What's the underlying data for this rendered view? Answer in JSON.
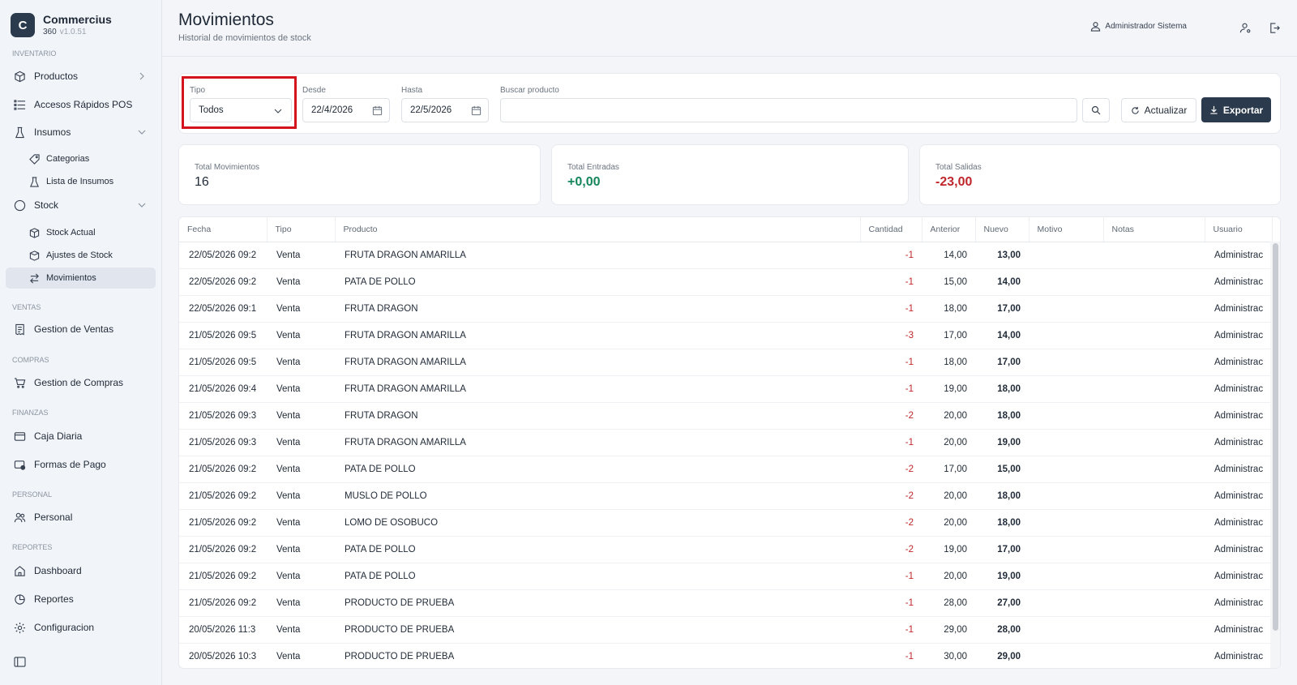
{
  "brand": {
    "logo_letter": "C",
    "name": "Commercius",
    "product": "360",
    "version": "v1.0.51"
  },
  "sidebar": {
    "sections": {
      "inventario": "INVENTARIO",
      "ventas": "VENTAS",
      "compras": "COMPRAS",
      "finanzas": "FINANZAS",
      "personal": "PERSONAL",
      "reportes": "REPORTES"
    },
    "items": {
      "productos": "Productos",
      "accesos": "Accesos Rápidos POS",
      "insumos": "Insumos",
      "categorias": "Categorias",
      "lista_insumos": "Lista de Insumos",
      "stock": "Stock",
      "stock_actual": "Stock Actual",
      "ajustes": "Ajustes de Stock",
      "movimientos": "Movimientos",
      "gestion_ventas": "Gestion de Ventas",
      "gestion_compras": "Gestion de Compras",
      "caja": "Caja Diaria",
      "formas_pago": "Formas de Pago",
      "personal": "Personal",
      "dashboard": "Dashboard",
      "reportes": "Reportes",
      "configuracion": "Configuracion"
    },
    "active_item": "movimientos"
  },
  "header": {
    "title": "Movimientos",
    "subtitle": "Historial de movimientos de stock",
    "user": "Administrador Sistema"
  },
  "filters": {
    "tipo_label": "Tipo",
    "tipo_value": "Todos",
    "desde_label": "Desde",
    "desde_value": "22/4/2026",
    "hasta_label": "Hasta",
    "hasta_value": "22/5/2026",
    "buscar_label": "Buscar producto",
    "buscar_value": "",
    "actualizar": "Actualizar",
    "exportar": "Exportar"
  },
  "stats": {
    "total_mov_label": "Total Movimientos",
    "total_mov_value": "16",
    "entradas_label": "Total Entradas",
    "entradas_value": "+0,00",
    "salidas_label": "Total Salidas",
    "salidas_value": "-23,00"
  },
  "table": {
    "headers": [
      "Fecha",
      "Tipo",
      "Producto",
      "Cantidad",
      "Anterior",
      "Nuevo",
      "Motivo",
      "Notas",
      "Usuario"
    ],
    "rows": [
      [
        "22/05/2026 09:2",
        "Venta",
        "FRUTA DRAGON AMARILLA",
        "-1",
        "14,00",
        "13,00",
        "",
        "",
        "Administrac"
      ],
      [
        "22/05/2026 09:2",
        "Venta",
        "PATA DE POLLO",
        "-1",
        "15,00",
        "14,00",
        "",
        "",
        "Administrac"
      ],
      [
        "22/05/2026 09:1",
        "Venta",
        "FRUTA DRAGON",
        "-1",
        "18,00",
        "17,00",
        "",
        "",
        "Administrac"
      ],
      [
        "21/05/2026 09:5",
        "Venta",
        "FRUTA DRAGON AMARILLA",
        "-3",
        "17,00",
        "14,00",
        "",
        "",
        "Administrac"
      ],
      [
        "21/05/2026 09:5",
        "Venta",
        "FRUTA DRAGON AMARILLA",
        "-1",
        "18,00",
        "17,00",
        "",
        "",
        "Administrac"
      ],
      [
        "21/05/2026 09:4",
        "Venta",
        "FRUTA DRAGON AMARILLA",
        "-1",
        "19,00",
        "18,00",
        "",
        "",
        "Administrac"
      ],
      [
        "21/05/2026 09:3",
        "Venta",
        "FRUTA DRAGON",
        "-2",
        "20,00",
        "18,00",
        "",
        "",
        "Administrac"
      ],
      [
        "21/05/2026 09:3",
        "Venta",
        "FRUTA DRAGON AMARILLA",
        "-1",
        "20,00",
        "19,00",
        "",
        "",
        "Administrac"
      ],
      [
        "21/05/2026 09:2",
        "Venta",
        "PATA DE POLLO",
        "-2",
        "17,00",
        "15,00",
        "",
        "",
        "Administrac"
      ],
      [
        "21/05/2026 09:2",
        "Venta",
        "MUSLO DE POLLO",
        "-2",
        "20,00",
        "18,00",
        "",
        "",
        "Administrac"
      ],
      [
        "21/05/2026 09:2",
        "Venta",
        "LOMO DE OSOBUCO",
        "-2",
        "20,00",
        "18,00",
        "",
        "",
        "Administrac"
      ],
      [
        "21/05/2026 09:2",
        "Venta",
        "PATA DE POLLO",
        "-2",
        "19,00",
        "17,00",
        "",
        "",
        "Administrac"
      ],
      [
        "21/05/2026 09:2",
        "Venta",
        "PATA DE POLLO",
        "-1",
        "20,00",
        "19,00",
        "",
        "",
        "Administrac"
      ],
      [
        "21/05/2026 09:2",
        "Venta",
        "PRODUCTO DE PRUEBA",
        "-1",
        "28,00",
        "27,00",
        "",
        "",
        "Administrac"
      ],
      [
        "20/05/2026 11:3",
        "Venta",
        "PRODUCTO DE PRUEBA",
        "-1",
        "29,00",
        "28,00",
        "",
        "",
        "Administrac"
      ],
      [
        "20/05/2026 10:3",
        "Venta",
        "PRODUCTO DE PRUEBA",
        "-1",
        "30,00",
        "29,00",
        "",
        "",
        "Administrac"
      ]
    ]
  },
  "colors": {
    "accent": "#2c3a4d",
    "negative": "#c0262b",
    "positive": "#15865a",
    "highlight": "#d3141c"
  },
  "icons": [
    "box-icon",
    "list-icon",
    "flask-icon",
    "tag-icon",
    "beaker-icon",
    "circle-icon",
    "chevron-right-icon",
    "chevron-down-icon",
    "stock-icon",
    "swap-icon",
    "receipt-icon",
    "cart-icon",
    "wallet-icon",
    "card-icon",
    "users-icon",
    "home-icon",
    "report-icon",
    "gear-icon",
    "sidebar-toggle-icon",
    "user-icon",
    "user-settings-icon",
    "logout-icon",
    "calendar-icon",
    "search-icon",
    "refresh-icon",
    "download-icon"
  ]
}
